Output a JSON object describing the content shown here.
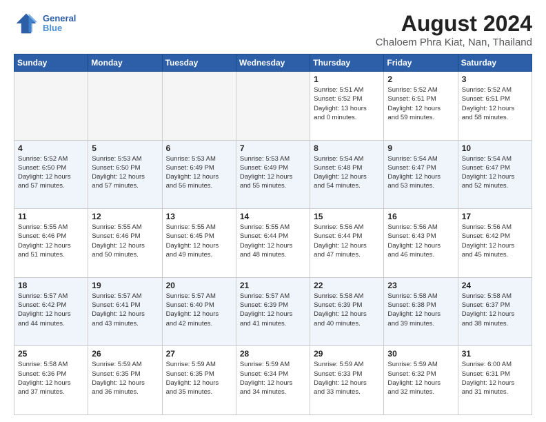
{
  "logo": {
    "line1": "General",
    "line2": "Blue"
  },
  "title": "August 2024",
  "subtitle": "Chaloem Phra Kiat, Nan, Thailand",
  "days_of_week": [
    "Sunday",
    "Monday",
    "Tuesday",
    "Wednesday",
    "Thursday",
    "Friday",
    "Saturday"
  ],
  "weeks": [
    [
      {
        "day": "",
        "info": ""
      },
      {
        "day": "",
        "info": ""
      },
      {
        "day": "",
        "info": ""
      },
      {
        "day": "",
        "info": ""
      },
      {
        "day": "1",
        "info": "Sunrise: 5:51 AM\nSunset: 6:52 PM\nDaylight: 13 hours\nand 0 minutes."
      },
      {
        "day": "2",
        "info": "Sunrise: 5:52 AM\nSunset: 6:51 PM\nDaylight: 12 hours\nand 59 minutes."
      },
      {
        "day": "3",
        "info": "Sunrise: 5:52 AM\nSunset: 6:51 PM\nDaylight: 12 hours\nand 58 minutes."
      }
    ],
    [
      {
        "day": "4",
        "info": "Sunrise: 5:52 AM\nSunset: 6:50 PM\nDaylight: 12 hours\nand 57 minutes."
      },
      {
        "day": "5",
        "info": "Sunrise: 5:53 AM\nSunset: 6:50 PM\nDaylight: 12 hours\nand 57 minutes."
      },
      {
        "day": "6",
        "info": "Sunrise: 5:53 AM\nSunset: 6:49 PM\nDaylight: 12 hours\nand 56 minutes."
      },
      {
        "day": "7",
        "info": "Sunrise: 5:53 AM\nSunset: 6:49 PM\nDaylight: 12 hours\nand 55 minutes."
      },
      {
        "day": "8",
        "info": "Sunrise: 5:54 AM\nSunset: 6:48 PM\nDaylight: 12 hours\nand 54 minutes."
      },
      {
        "day": "9",
        "info": "Sunrise: 5:54 AM\nSunset: 6:47 PM\nDaylight: 12 hours\nand 53 minutes."
      },
      {
        "day": "10",
        "info": "Sunrise: 5:54 AM\nSunset: 6:47 PM\nDaylight: 12 hours\nand 52 minutes."
      }
    ],
    [
      {
        "day": "11",
        "info": "Sunrise: 5:55 AM\nSunset: 6:46 PM\nDaylight: 12 hours\nand 51 minutes."
      },
      {
        "day": "12",
        "info": "Sunrise: 5:55 AM\nSunset: 6:46 PM\nDaylight: 12 hours\nand 50 minutes."
      },
      {
        "day": "13",
        "info": "Sunrise: 5:55 AM\nSunset: 6:45 PM\nDaylight: 12 hours\nand 49 minutes."
      },
      {
        "day": "14",
        "info": "Sunrise: 5:55 AM\nSunset: 6:44 PM\nDaylight: 12 hours\nand 48 minutes."
      },
      {
        "day": "15",
        "info": "Sunrise: 5:56 AM\nSunset: 6:44 PM\nDaylight: 12 hours\nand 47 minutes."
      },
      {
        "day": "16",
        "info": "Sunrise: 5:56 AM\nSunset: 6:43 PM\nDaylight: 12 hours\nand 46 minutes."
      },
      {
        "day": "17",
        "info": "Sunrise: 5:56 AM\nSunset: 6:42 PM\nDaylight: 12 hours\nand 45 minutes."
      }
    ],
    [
      {
        "day": "18",
        "info": "Sunrise: 5:57 AM\nSunset: 6:42 PM\nDaylight: 12 hours\nand 44 minutes."
      },
      {
        "day": "19",
        "info": "Sunrise: 5:57 AM\nSunset: 6:41 PM\nDaylight: 12 hours\nand 43 minutes."
      },
      {
        "day": "20",
        "info": "Sunrise: 5:57 AM\nSunset: 6:40 PM\nDaylight: 12 hours\nand 42 minutes."
      },
      {
        "day": "21",
        "info": "Sunrise: 5:57 AM\nSunset: 6:39 PM\nDaylight: 12 hours\nand 41 minutes."
      },
      {
        "day": "22",
        "info": "Sunrise: 5:58 AM\nSunset: 6:39 PM\nDaylight: 12 hours\nand 40 minutes."
      },
      {
        "day": "23",
        "info": "Sunrise: 5:58 AM\nSunset: 6:38 PM\nDaylight: 12 hours\nand 39 minutes."
      },
      {
        "day": "24",
        "info": "Sunrise: 5:58 AM\nSunset: 6:37 PM\nDaylight: 12 hours\nand 38 minutes."
      }
    ],
    [
      {
        "day": "25",
        "info": "Sunrise: 5:58 AM\nSunset: 6:36 PM\nDaylight: 12 hours\nand 37 minutes."
      },
      {
        "day": "26",
        "info": "Sunrise: 5:59 AM\nSunset: 6:35 PM\nDaylight: 12 hours\nand 36 minutes."
      },
      {
        "day": "27",
        "info": "Sunrise: 5:59 AM\nSunset: 6:35 PM\nDaylight: 12 hours\nand 35 minutes."
      },
      {
        "day": "28",
        "info": "Sunrise: 5:59 AM\nSunset: 6:34 PM\nDaylight: 12 hours\nand 34 minutes."
      },
      {
        "day": "29",
        "info": "Sunrise: 5:59 AM\nSunset: 6:33 PM\nDaylight: 12 hours\nand 33 minutes."
      },
      {
        "day": "30",
        "info": "Sunrise: 5:59 AM\nSunset: 6:32 PM\nDaylight: 12 hours\nand 32 minutes."
      },
      {
        "day": "31",
        "info": "Sunrise: 6:00 AM\nSunset: 6:31 PM\nDaylight: 12 hours\nand 31 minutes."
      }
    ]
  ]
}
